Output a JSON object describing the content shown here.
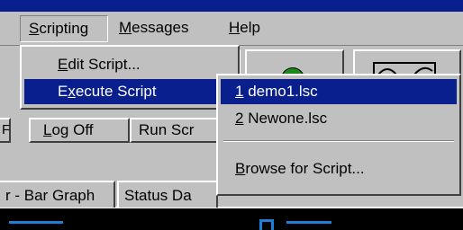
{
  "menubar": {
    "items": [
      {
        "label": "Scripting",
        "mnemonic": "S",
        "rest": "cripting"
      },
      {
        "label": "Messages",
        "mnemonic": "M",
        "rest": "essages"
      },
      {
        "label": "Help",
        "mnemonic": "H",
        "rest": "elp"
      }
    ]
  },
  "scripting_menu": {
    "edit_script": {
      "pre": "",
      "mn": "E",
      "post": "dit Script..."
    },
    "execute_script": {
      "pre": "E",
      "mn": "x",
      "post": "ecute Script",
      "arrow": "▶"
    }
  },
  "execute_submenu": {
    "items": [
      {
        "mn": "1",
        "post": " demo1.lsc"
      },
      {
        "mn": "2",
        "post": " Newone.lsc"
      }
    ],
    "browse": {
      "mn": "B",
      "post": "rowse for Script..."
    }
  },
  "toolbar": {
    "log_off": {
      "pre": "",
      "mn": "L",
      "post": "og Off"
    },
    "run_script_partial": "Run Scr"
  },
  "tabs": [
    "r - Bar Graph",
    "Status Da"
  ],
  "colors": {
    "face": "#c0c0c0",
    "highlight": "#0a1f8e",
    "title_bar": "#0a1f8e",
    "status_led": "#1a8a1a",
    "display_bg": "#000000",
    "display_fg": "#1a7fd6"
  }
}
